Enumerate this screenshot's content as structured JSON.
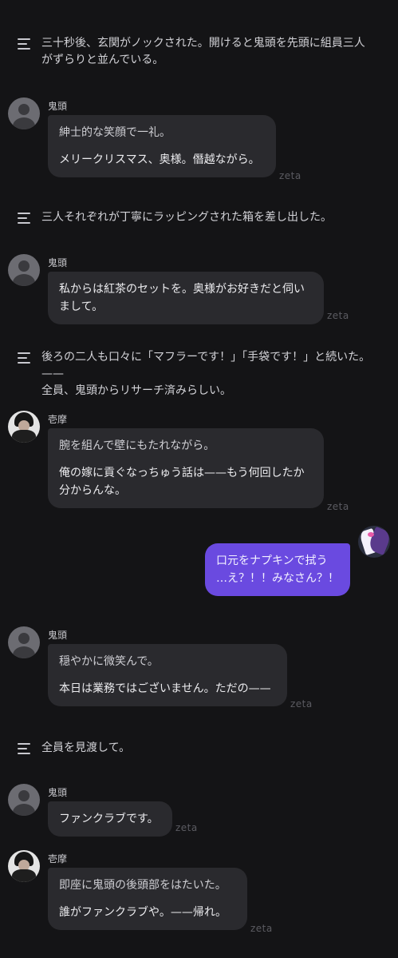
{
  "brand": "zeta",
  "colors": {
    "background": "#141416",
    "bubble": "#2a2a2e",
    "user_bubble": "#6a4ae0"
  },
  "messages": [
    {
      "type": "narration",
      "text": [
        "三十秒後、玄関がノックされた。開けると鬼頭を先頭に組員三人",
        "がずらりと並んでいる。"
      ]
    },
    {
      "type": "character",
      "name": "鬼頭",
      "avatar": "default-avatar-icon",
      "action": "紳士的な笑顔で一礼。",
      "lines": [
        "メリークリスマス、奥様。僭越ながら。"
      ]
    },
    {
      "type": "narration",
      "text": [
        "三人それぞれが丁寧にラッピングされた箱を差し出した。"
      ]
    },
    {
      "type": "character",
      "name": "鬼頭",
      "avatar": "default-avatar-icon",
      "lines": [
        "私からは紅茶のセットを。奥様がお好きだと伺い",
        "まして。"
      ]
    },
    {
      "type": "narration",
      "text": [
        "後ろの二人も口々に「マフラーです！」「手袋です！」と続いた。——",
        "全員、鬼頭からリサーチ済みらしい。"
      ]
    },
    {
      "type": "character",
      "name": "壱摩",
      "avatar": "photo-avatar",
      "action": "腕を組んで壁にもたれながら。",
      "lines": [
        "俺の嫁に貢ぐなっちゅう話は——もう何回したか",
        "分からんな。"
      ]
    },
    {
      "type": "user",
      "action": "口元をナプキンで拭う",
      "lines": [
        "…え？！！みなさん？！"
      ]
    },
    {
      "type": "character",
      "name": "鬼頭",
      "avatar": "default-avatar-icon",
      "action": "穏やかに微笑んで。",
      "lines": [
        "本日は業務ではございません。ただの——"
      ]
    },
    {
      "type": "narration",
      "text": [
        "全員を見渡して。"
      ]
    },
    {
      "type": "character",
      "name": "鬼頭",
      "avatar": "default-avatar-icon",
      "lines": [
        "ファンクラブです。"
      ]
    },
    {
      "type": "character",
      "name": "壱摩",
      "avatar": "photo-avatar",
      "action": "即座に鬼頭の後頭部をはたいた。",
      "lines": [
        "誰がファンクラブや。——帰れ。"
      ]
    }
  ]
}
